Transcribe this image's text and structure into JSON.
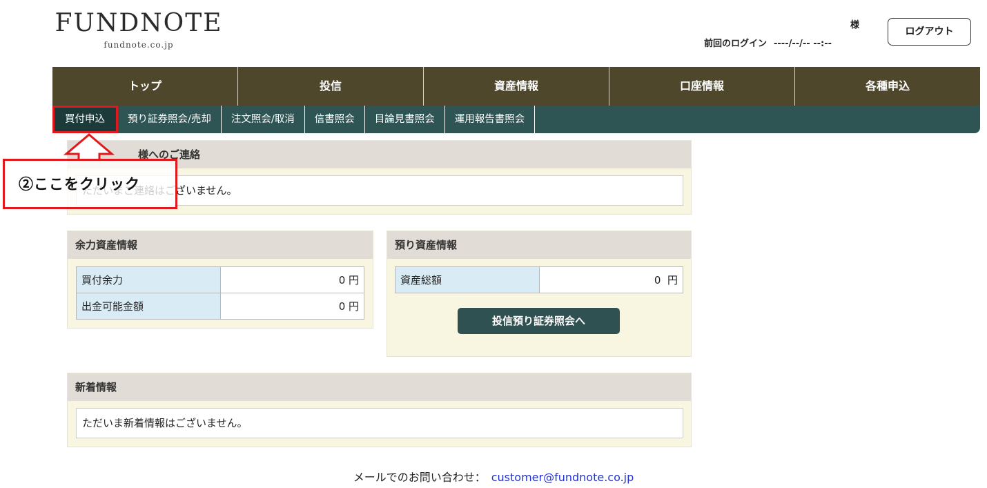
{
  "header": {
    "logo_main": "FUNDNOTE",
    "logo_sub": "fundnote.co.jp",
    "user_honorific": "様",
    "last_login_label": "前回のログイン",
    "last_login_value": "----/--/-- --:--",
    "logout_label": "ログアウト"
  },
  "main_nav": [
    "トップ",
    "投信",
    "資産情報",
    "口座情報",
    "各種申込"
  ],
  "sub_nav": [
    "買付申込",
    "預り証券照会/売却",
    "注文照会/取消",
    "信書照会",
    "目論見書照会",
    "運用報告書照会"
  ],
  "notice": {
    "title": "様へのご連絡",
    "message": "ただいまご連絡はございません。"
  },
  "buying_power": {
    "title": "余力資産情報",
    "rows": [
      {
        "label": "買付余力",
        "value": "0 円"
      },
      {
        "label": "出金可能金額",
        "value": "0 円"
      }
    ]
  },
  "holdings": {
    "title": "預り資産情報",
    "rows": [
      {
        "label": "資産総額",
        "value": "0  円"
      }
    ],
    "button_label": "投信預り証券照会へ"
  },
  "news": {
    "title": "新着情報",
    "message": "ただいま新着情報はございません。"
  },
  "footer": {
    "label": "メールでのお問い合わせ：",
    "email": "customer@fundnote.co.jp"
  },
  "annotation": {
    "text": "②ここをクリック",
    "color": "#e0191c"
  }
}
